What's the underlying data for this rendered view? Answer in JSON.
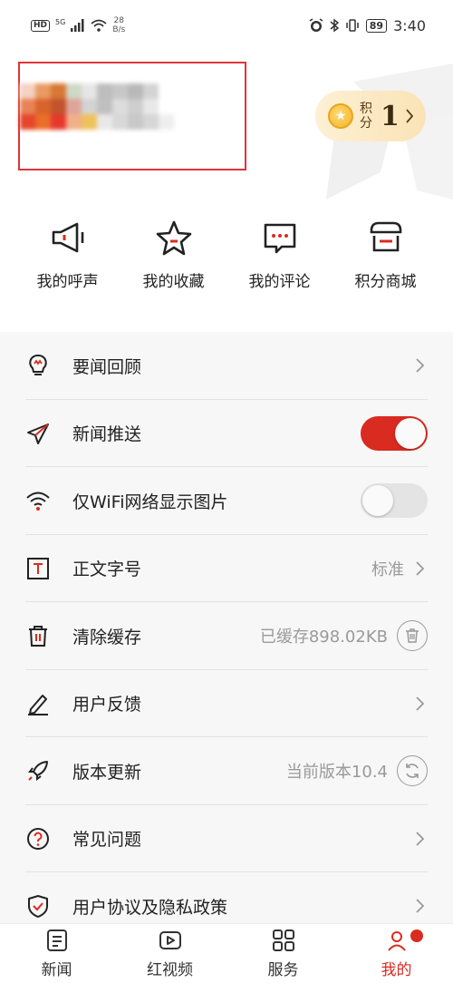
{
  "status_bar": {
    "left_badge": "HD",
    "signal": "5G",
    "net_speed_value": "28",
    "net_speed_unit": "B/s",
    "battery": "89",
    "time": "3:40"
  },
  "profile": {
    "points_label_line1": "积",
    "points_label_line2": "分",
    "points_value": "1"
  },
  "quick_actions": [
    {
      "label": "我的呼声",
      "icon": "megaphone-icon"
    },
    {
      "label": "我的收藏",
      "icon": "star-icon"
    },
    {
      "label": "我的评论",
      "icon": "comment-icon"
    },
    {
      "label": "积分商城",
      "icon": "store-icon"
    }
  ],
  "settings": {
    "key_news_review": {
      "label": "要闻回顾",
      "icon": "lightbulb-icon"
    },
    "news_push": {
      "label": "新闻推送",
      "icon": "paper-plane-icon",
      "toggle": "on"
    },
    "wifi_images": {
      "label": "仅WiFi网络显示图片",
      "icon": "wifi-icon",
      "toggle": "off"
    },
    "font_size": {
      "label": "正文字号",
      "icon": "text-size-icon",
      "value": "标准"
    },
    "clear_cache": {
      "label": "清除缓存",
      "icon": "trash-icon",
      "value": "已缓存898.02KB"
    },
    "feedback": {
      "label": "用户反馈",
      "icon": "pencil-icon"
    },
    "update": {
      "label": "版本更新",
      "icon": "rocket-icon",
      "value": "当前版本10.4"
    },
    "faq": {
      "label": "常见问题",
      "icon": "question-icon"
    },
    "privacy": {
      "label": "用户协议及隐私政策",
      "icon": "shield-icon"
    }
  },
  "bottom_nav": [
    {
      "label": "新闻",
      "icon": "news-icon"
    },
    {
      "label": "红视频",
      "icon": "video-icon"
    },
    {
      "label": "服务",
      "icon": "grid-icon"
    },
    {
      "label": "我的",
      "icon": "profile-icon",
      "active": true
    }
  ],
  "colors": {
    "accent": "#d92b20",
    "list_background": "#f7f7f7",
    "points_pill": "#fae3b6"
  }
}
